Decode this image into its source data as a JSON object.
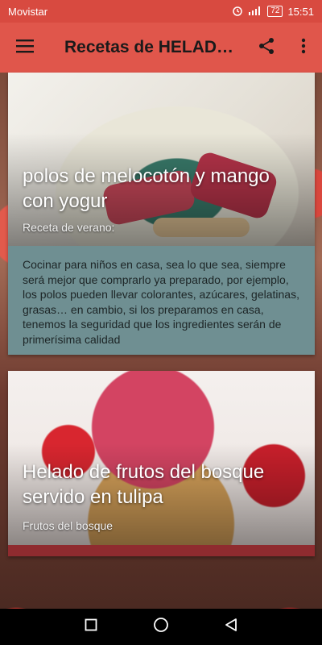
{
  "status_bar": {
    "carrier": "Movistar",
    "battery": "72",
    "time": "15:51"
  },
  "app_bar": {
    "title": "Recetas de HELAD…",
    "icons": [
      "menu-icon",
      "share-icon",
      "more-vert-icon"
    ]
  },
  "recipes": [
    {
      "title": "polos de melocotón y mango con yogur",
      "subtitle": "Receta de verano:",
      "description": "Cocinar para niños en casa, sea lo que sea, siempre será mejor que comprarlo ya preparado, por ejemplo, los polos pueden llevar colorantes, azúcares, gelatinas, grasas… en cambio, si los preparamos en casa, tenemos la seguridad que los ingredientes serán de primerísima calidad"
    },
    {
      "title": "Helado de frutos del bosque servido en tulipa",
      "subtitle": "Frutos del bosque"
    }
  ],
  "nav_bar": {
    "icons": [
      "recent-apps-icon",
      "home-icon",
      "back-icon"
    ]
  },
  "colors": {
    "status_bar": "#d84a40",
    "app_bar": "#e0564b",
    "card_body": "#6f8f92"
  }
}
